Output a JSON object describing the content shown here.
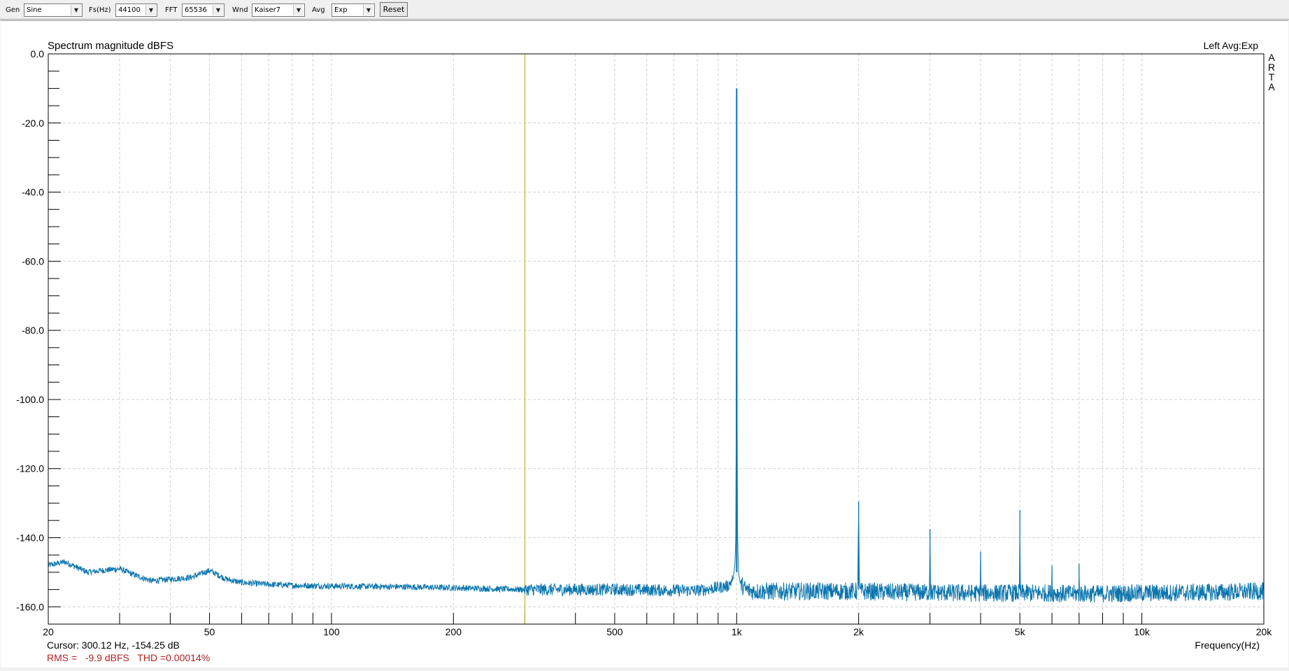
{
  "toolbar": {
    "gen": {
      "label": "Gen",
      "value": "Sine"
    },
    "fs": {
      "label": "Fs(Hz)",
      "value": "44100"
    },
    "fft": {
      "label": "FFT",
      "value": "65536"
    },
    "wnd": {
      "label": "Wnd",
      "value": "Kaiser7"
    },
    "avg": {
      "label": "Avg",
      "value": "Exp"
    },
    "reset_label": "Reset"
  },
  "plot": {
    "title": "Spectrum magnitude dBFS",
    "channel_info": "Left  Avg:Exp",
    "brand_letters": [
      "A",
      "R",
      "T",
      "A"
    ],
    "cursor_text": "Cursor: 300.12 Hz, -154.25 dB",
    "rms_text": "RMS =   -9.9 dBFS   THD =0.00014%",
    "colors": {
      "trace": "#0b75ad",
      "cursor_line": "#c8b43c",
      "grid": "#d2d2d2",
      "status_text": "#b22222"
    }
  },
  "chart_data": {
    "type": "line",
    "title": "Spectrum magnitude dBFS",
    "xlabel": "Frequency(Hz)",
    "ylabel": "",
    "x_scale": "log",
    "xlim": [
      20,
      20000
    ],
    "ylim": [
      -165,
      0
    ],
    "y_ticks": [
      0,
      -20,
      -40,
      -60,
      -80,
      -100,
      -120,
      -140,
      -160
    ],
    "y_tick_labels": [
      "0.0",
      "-20.0",
      "-40.0",
      "-60.0",
      "-80.0",
      "-100.0",
      "-120.0",
      "-140.0",
      "-160.0"
    ],
    "x_ticks": [
      20,
      50,
      100,
      200,
      500,
      1000,
      2000,
      5000,
      10000,
      20000
    ],
    "x_tick_labels": [
      "20",
      "50",
      "100",
      "200",
      "500",
      "1k",
      "2k",
      "5k",
      "10k",
      "20k"
    ],
    "grid": true,
    "cursor_frequency_hz": 300.12,
    "series": [
      {
        "name": "Left",
        "x": [
          20,
          22,
          25,
          27,
          30,
          33,
          36,
          40,
          45,
          50,
          55,
          60,
          70,
          80,
          100,
          150,
          200,
          300,
          500,
          800,
          950,
          980,
          990,
          995,
          998,
          1000,
          1002,
          1005,
          1010,
          1020,
          1050,
          1100,
          1500,
          1990,
          2000,
          2010,
          2500,
          2990,
          3000,
          3010,
          3500,
          3990,
          4000,
          4010,
          4500,
          4990,
          5000,
          5010,
          5500,
          5990,
          6000,
          6010,
          6500,
          6990,
          7000,
          7010,
          8000,
          10000,
          15000,
          20000
        ],
        "y": [
          -148,
          -147,
          -150,
          -149.5,
          -149,
          -151,
          -152.5,
          -152,
          -151.5,
          -149.5,
          -152,
          -153,
          -153.5,
          -153.8,
          -154,
          -154.2,
          -154.5,
          -155,
          -155,
          -155.3,
          -154,
          -152,
          -148,
          -140,
          -100,
          -10,
          -95,
          -138,
          -150,
          -153,
          -155,
          -155.5,
          -155.5,
          -155.5,
          -129.5,
          -155.5,
          -155.8,
          -155.8,
          -137.5,
          -155.8,
          -156,
          -156,
          -144,
          -156,
          -156,
          -156,
          -132,
          -156,
          -156,
          -156,
          -148,
          -156,
          -156.2,
          -156.2,
          -147.5,
          -156.2,
          -156.2,
          -156,
          -155.8,
          -155.5
        ]
      }
    ]
  }
}
